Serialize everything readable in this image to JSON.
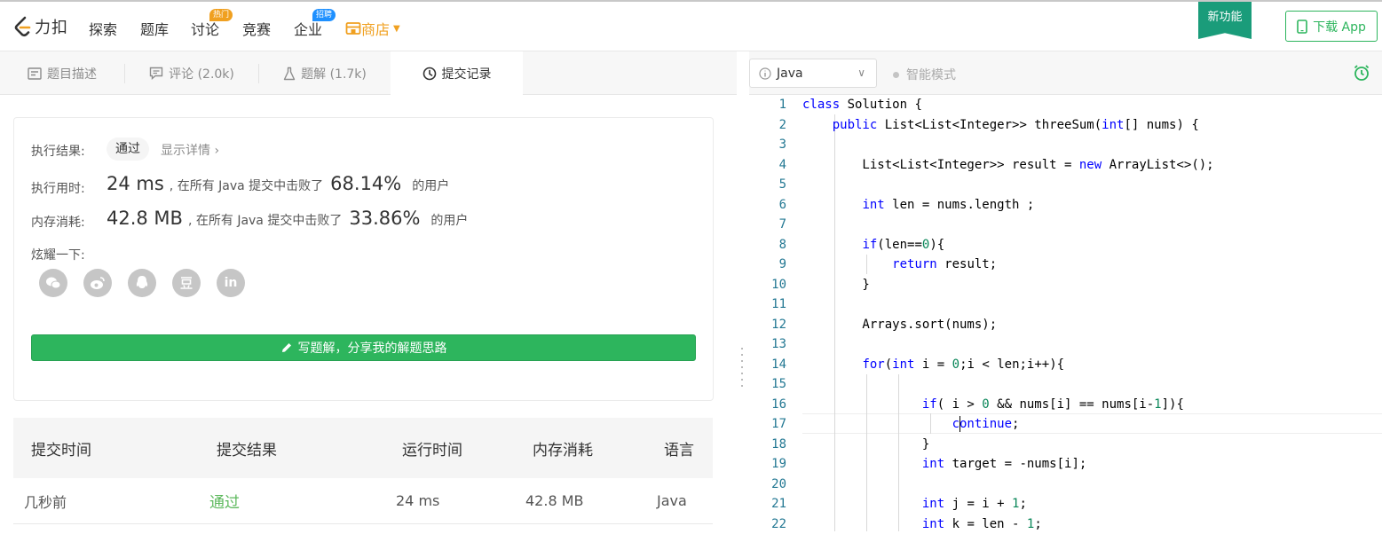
{
  "nav": {
    "logo_text": "力扣",
    "items": [
      {
        "label": "探索"
      },
      {
        "label": "题库"
      },
      {
        "label": "讨论",
        "badge": "热门",
        "badge_color": "#f0a020"
      },
      {
        "label": "竞赛"
      },
      {
        "label": "企业",
        "badge": "招聘",
        "badge_color": "#1e90ff"
      }
    ],
    "store_label": "商店",
    "new_feature": "新功能",
    "download_label": "下载 App",
    "accent": "#2db55d",
    "store_color": "#f0a020"
  },
  "tabs": [
    {
      "label": "题目描述",
      "icon": "description-icon"
    },
    {
      "label": "评论 (2.0k)",
      "icon": "comment-icon"
    },
    {
      "label": "题解 (1.7k)",
      "icon": "flask-icon"
    },
    {
      "label": "提交记录",
      "icon": "clock-icon",
      "active": true
    }
  ],
  "result": {
    "exec_label": "执行结果:",
    "status": "通过",
    "detail_link": "显示详情 ›",
    "time_label": "执行用时:",
    "time_value": "24 ms",
    "time_mid": ", 在所有 Java 提交中击败了",
    "time_pct": "68.14%",
    "time_tail": "的用户",
    "mem_label": "内存消耗:",
    "mem_value": "42.8 MB",
    "mem_mid": ", 在所有 Java 提交中击败了",
    "mem_pct": "33.86%",
    "mem_tail": "的用户",
    "share_label": "炫耀一下:",
    "share_icons": [
      "wechat-icon",
      "weibo-icon",
      "qq-icon",
      "douban-icon",
      "linkedin-icon"
    ],
    "write_button": "写题解，分享我的解题思路"
  },
  "table": {
    "headers": [
      "提交时间",
      "提交结果",
      "运行时间",
      "内存消耗",
      "语言"
    ],
    "rows": [
      {
        "time": "几秒前",
        "result": "通过",
        "runtime": "24 ms",
        "memory": "42.8 MB",
        "lang": "Java"
      }
    ],
    "pass_color": "#5cb85c"
  },
  "editor": {
    "language": "Java",
    "smart_mode": "智能模式",
    "line_numbers": [
      "1",
      "2",
      "3",
      "4",
      "5",
      "6",
      "7",
      "8",
      "9",
      "10",
      "11",
      "12",
      "13",
      "14",
      "15",
      "16",
      "17",
      "18",
      "19",
      "20",
      "21",
      "22"
    ],
    "lines": [
      "class Solution {",
      "    public List<List<Integer>> threeSum(int[] nums) {",
      "",
      "        List<List<Integer>> result = new ArrayList<>();",
      "",
      "        int len = nums.length ;",
      "",
      "        if(len==0){",
      "            return result;",
      "        }",
      "",
      "        Arrays.sort(nums);",
      "",
      "        for(int i = 0;i < len;i++){",
      "",
      "                if( i > 0 && nums[i] == nums[i-1]){",
      "                    continue;",
      "                }",
      "                int target = -nums[i];",
      "",
      "                int j = i + 1;",
      "                int k = len - 1;"
    ]
  }
}
